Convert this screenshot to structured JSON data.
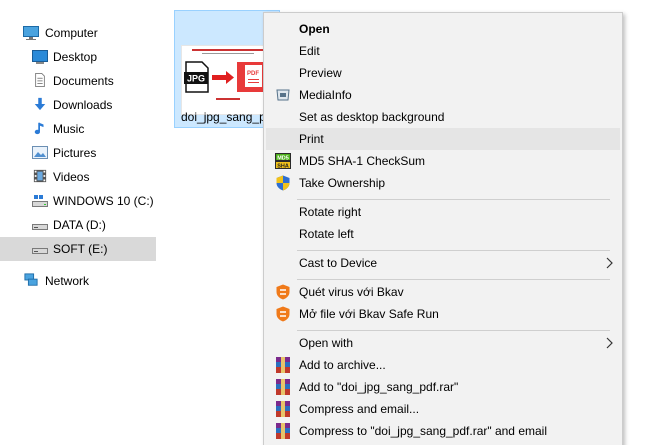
{
  "nav": {
    "items": [
      {
        "label": "Computer",
        "icon": "computer-icon"
      },
      {
        "label": "Desktop",
        "icon": "desktop-icon"
      },
      {
        "label": "Documents",
        "icon": "documents-icon"
      },
      {
        "label": "Downloads",
        "icon": "downloads-icon"
      },
      {
        "label": "Music",
        "icon": "music-icon"
      },
      {
        "label": "Pictures",
        "icon": "pictures-icon"
      },
      {
        "label": "Videos",
        "icon": "videos-icon"
      },
      {
        "label": "WINDOWS 10 (C:)",
        "icon": "drive-c-icon"
      },
      {
        "label": "DATA (D:)",
        "icon": "drive-icon"
      },
      {
        "label": "SOFT (E:)",
        "icon": "drive-icon",
        "selected": true
      },
      {
        "label": "Network",
        "icon": "network-icon"
      }
    ]
  },
  "file": {
    "name": "doi_jpg_sang_pdf",
    "thumb_text": "JPG",
    "thumb_pdf": "PDF"
  },
  "menu": {
    "items": [
      {
        "label": "Open",
        "bold": true
      },
      {
        "label": "Edit"
      },
      {
        "label": "Preview"
      },
      {
        "label": "MediaInfo",
        "icon": "mediainfo-icon"
      },
      {
        "label": "Set as desktop background"
      },
      {
        "label": "Print",
        "hover": true
      },
      {
        "label": "MD5 SHA-1 CheckSum",
        "icon": "checksum-icon"
      },
      {
        "label": "Take Ownership",
        "icon": "shield-icon"
      },
      {
        "label": "Rotate right"
      },
      {
        "label": "Rotate left"
      },
      {
        "label": "Cast to Device",
        "submenu": true
      },
      {
        "label": "Quét virus với Bkav",
        "icon": "bkav-icon"
      },
      {
        "label": "Mở file với Bkav Safe Run",
        "icon": "bkav-icon"
      },
      {
        "label": "Open with",
        "submenu": true
      },
      {
        "label": "Add to archive...",
        "icon": "winrar-icon"
      },
      {
        "label": "Add to \"doi_jpg_sang_pdf.rar\"",
        "icon": "winrar-icon"
      },
      {
        "label": "Compress and email...",
        "icon": "winrar-icon"
      },
      {
        "label": "Compress to \"doi_jpg_sang_pdf.rar\" and email",
        "icon": "winrar-icon"
      }
    ]
  },
  "colors": {
    "selection": "#cce8ff",
    "menu_bg": "#f2f2f2",
    "hover": "#e5e5e5"
  }
}
